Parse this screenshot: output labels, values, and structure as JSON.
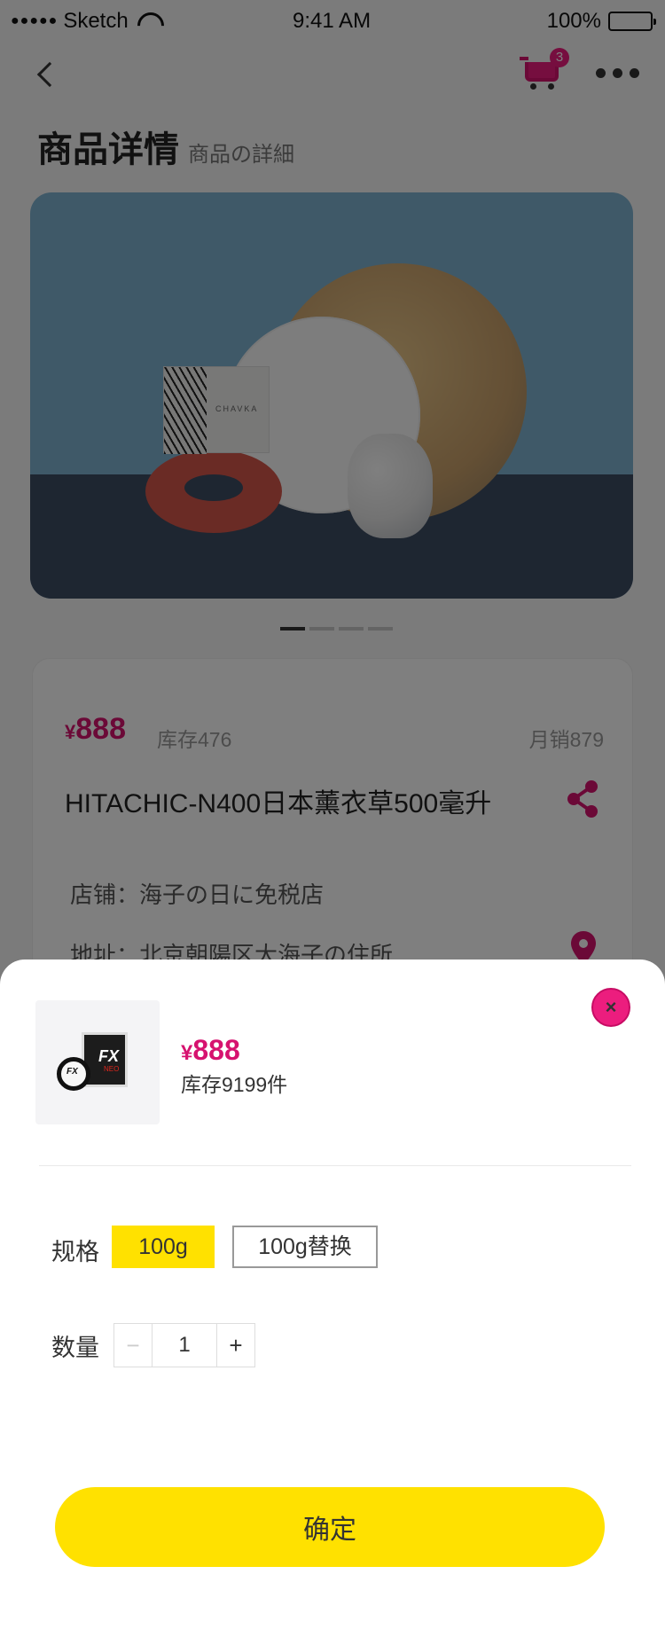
{
  "status_bar": {
    "signal": "●●●●●",
    "carrier": "Sketch",
    "time": "9:41 AM",
    "battery": "100%"
  },
  "nav": {
    "cart_count": "3"
  },
  "header": {
    "title": "商品详情",
    "subtitle": "商品の詳細"
  },
  "hero": {
    "box_label": "CHAVKA",
    "carousel_count": 4,
    "carousel_active": 0
  },
  "product": {
    "currency": "¥",
    "price": "888",
    "stock": "库存476",
    "monthly_sales": "月销879",
    "name": "HITACHIC-N400日本薰衣草500毫升",
    "store": "店铺：海子の日に免税店",
    "address": "地址：北京朝陽区大海子の住所"
  },
  "sheet": {
    "currency": "¥",
    "price": "888",
    "stock": "库存9199件",
    "thumb_label": "FX",
    "thumb_label_red": "NEO",
    "spec_label": "规格",
    "spec_options": [
      "100g",
      "100g替换"
    ],
    "spec_selected": "100g",
    "qty_label": "数量",
    "qty_minus": "−",
    "qty_value": "1",
    "qty_plus": "+",
    "confirm": "确定",
    "close": "×"
  },
  "colors": {
    "accent": "#ec1d7e",
    "price": "#d6126f",
    "button": "#ffe100"
  }
}
